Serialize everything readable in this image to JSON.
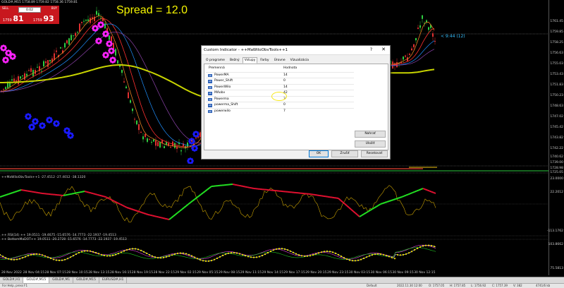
{
  "symbol_label": "GOLD#,M15  1758.89 1759.82 1758.36 1759.81",
  "spread_text": "Spread = 12.0",
  "price_tag": "< 9:44 (12)",
  "one_click": {
    "sell_label": "SELL",
    "buy_label": "BUY",
    "lot": "0.02",
    "sell_price_prefix": "1759",
    "sell_price_big": "81",
    "buy_price_prefix": "1759",
    "buy_price_big": "93"
  },
  "price_axis": [
    "1761.45",
    "1759.85",
    "1758.25",
    "1756.63",
    "1755.03",
    "1753.43",
    "1751.83",
    "1750.23",
    "1748.63",
    "1747.02",
    "1745.42",
    "1743.82",
    "1742.22",
    "1740.62",
    "1739.00"
  ],
  "sub_axis_1": [
    "1728.98",
    "1725.05"
  ],
  "sub_axis_2": [
    "23.0000",
    "22.2012",
    "-113.1762"
  ],
  "sub_axis_3": [
    "103.8662",
    "75.5813"
  ],
  "sub_labels": {
    "osc": "++MaWiloObvTools++1 -27.4512 -27.4012 -38.1320",
    "bottom": "++ RSI(14) ++ 19.0511 -19.4675 -15.6576 -14.7773 -22.1937 -19.4513",
    "bottom2": "++ BottomMaDOT++ 19.0511 -20.2728 -15.6576 -14.7773 -22.1937 -19.4513"
  },
  "time_axis": [
    "28 Nov 2022",
    "28 Nov 04:15",
    "28 Nov 07:15",
    "28 Nov 10:15",
    "28 Nov 13:15",
    "28 Nov 16:15",
    "28 Nov 19:15",
    "28 Nov 22:15",
    "29 Nov 02:15",
    "29 Nov 05:15",
    "29 Nov 08:15",
    "29 Nov 11:15",
    "29 Nov 14:15",
    "29 Nov 17:15",
    "29 Nov 20:15",
    "29 Nov 23:15",
    "30 Nov 03:15",
    "30 Nov 06:15",
    "30 Nov 09:15",
    "30 Nov 12:15"
  ],
  "chart_tabs": [
    "GOLD#,H1",
    "GOLD#,M15",
    "GOLD#,M1",
    "GOLD#,M15",
    "EURUSD#,H1"
  ],
  "active_chart_tab": 1,
  "status": {
    "left": "For Help, press F1",
    "mid": "Default",
    "time": "2022.11.30 12:00",
    "o": "O: 1757.05",
    "h": "H: 1757.85",
    "l": "L: 1756.92",
    "c": "C: 1757.39",
    "v": "V: 382",
    "conn": "4741/6 kb"
  },
  "dialog": {
    "title": "Custom Indicator - ++MaWiloObvTools++1",
    "help": "?",
    "close": "✕",
    "tabs": [
      "O programe",
      "Bežný",
      "Vstupy",
      "Farby",
      "Úrovne",
      "Vizualizácia"
    ],
    "active_tab": 2,
    "col_var": "Premenná",
    "col_val": "Hodnota",
    "rows": [
      {
        "icon": "ab",
        "name": "PowerMA",
        "value": "14"
      },
      {
        "icon": "ab",
        "name": "Power_Shift",
        "value": "0"
      },
      {
        "icon": "ab",
        "name": "PowerWilo",
        "value": "14"
      },
      {
        "icon": "ab",
        "name": "MAobv",
        "value": "42"
      },
      {
        "icon": "ab",
        "name": "Powerma",
        "value": "3"
      },
      {
        "icon": "ab",
        "name": "powerma_Shift",
        "value": "0"
      },
      {
        "icon": "ab",
        "name": "powerwilo",
        "value": "7"
      }
    ],
    "btn_load": "Nahrať",
    "btn_save": "Uložiť",
    "btn_ok": "OK",
    "btn_cancel": "Zrušiť",
    "btn_reset": "Resetovať"
  },
  "colors": {
    "spread": "#f5f500",
    "price_tag": "#35c0ff",
    "sell_buy": "#c8171e",
    "osc_up": "#22e022",
    "osc_down": "#e01030",
    "dots_magenta": "#ff22ff",
    "dots_blue": "#1a1aff",
    "yellow_ma": "#c8d400"
  }
}
